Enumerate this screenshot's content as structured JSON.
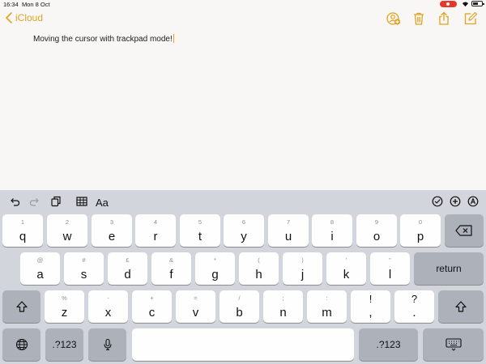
{
  "status_bar": {
    "time": "16:34",
    "date": "Mon 8 Oct"
  },
  "nav": {
    "back_label": "iCloud",
    "accent_color": "#e0a321",
    "icons": [
      "add-people-icon",
      "trash-icon",
      "share-icon",
      "compose-icon"
    ]
  },
  "note": {
    "text": "Moving the cursor with trackpad mode!"
  },
  "toolbar": {
    "format_label": "Aa",
    "icons": [
      "undo-icon",
      "redo-icon",
      "paste-icon",
      "table-icon",
      "checklist-icon",
      "insert-icon",
      "markup-icon"
    ]
  },
  "keyboard": {
    "row1": [
      {
        "top": "1",
        "main": "q"
      },
      {
        "top": "2",
        "main": "w"
      },
      {
        "top": "3",
        "main": "e"
      },
      {
        "top": "4",
        "main": "r"
      },
      {
        "top": "5",
        "main": "t"
      },
      {
        "top": "6",
        "main": "y"
      },
      {
        "top": "7",
        "main": "u"
      },
      {
        "top": "8",
        "main": "i"
      },
      {
        "top": "9",
        "main": "o"
      },
      {
        "top": "0",
        "main": "p"
      }
    ],
    "row2": [
      {
        "top": "@",
        "main": "a"
      },
      {
        "top": "#",
        "main": "s"
      },
      {
        "top": "£",
        "main": "d"
      },
      {
        "top": "&",
        "main": "f"
      },
      {
        "top": "*",
        "main": "g"
      },
      {
        "top": "(",
        "main": "h"
      },
      {
        "top": ")",
        "main": "j"
      },
      {
        "top": "'",
        "main": "k"
      },
      {
        "top": "\"",
        "main": "l"
      }
    ],
    "row3": [
      {
        "top": "%",
        "main": "z"
      },
      {
        "top": "-",
        "main": "x"
      },
      {
        "top": "+",
        "main": "c"
      },
      {
        "top": "=",
        "main": "v"
      },
      {
        "top": "/",
        "main": "b"
      },
      {
        "top": ";",
        "main": "n"
      },
      {
        "top": ":",
        "main": "m"
      },
      {
        "top": "!",
        "main": ","
      },
      {
        "top": "?",
        "main": "."
      }
    ],
    "return_label": "return",
    "numbers_label": ".?123"
  }
}
